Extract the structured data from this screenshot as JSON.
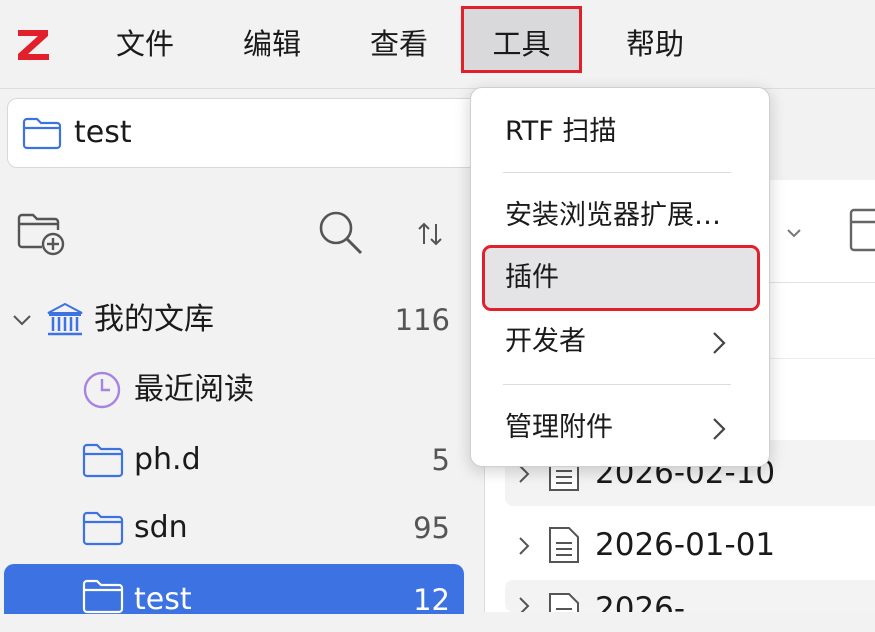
{
  "menubar": {
    "logo_icon": "zotero-z-logo",
    "items": [
      {
        "label": "文件"
      },
      {
        "label": "编辑"
      },
      {
        "label": "查看"
      },
      {
        "label": "工具"
      },
      {
        "label": "帮助"
      }
    ]
  },
  "collection_bar": {
    "icon": "folder-icon",
    "label": "test"
  },
  "sidebar": {
    "toolbar_icons": [
      "new-collection-icon",
      "search-icon",
      "sort-icon"
    ],
    "tree": [
      {
        "label": "我的文库",
        "count": "116",
        "icon": "library-icon"
      },
      {
        "label": "最近阅读",
        "count": "",
        "icon": "clock-icon"
      },
      {
        "label": "ph.d",
        "count": "5",
        "icon": "folder-icon"
      },
      {
        "label": "sdn",
        "count": "95",
        "icon": "folder-icon"
      },
      {
        "label": "test",
        "count": "12",
        "icon": "folder-icon"
      }
    ]
  },
  "items_pane": {
    "rows": [
      {
        "title": "2026-02-10",
        "icon": "document-icon"
      },
      {
        "title": "2026-01-01",
        "icon": "document-icon"
      },
      {
        "title": "2026-",
        "icon": "document-icon"
      }
    ]
  },
  "tools_menu": {
    "items": [
      {
        "label": "RTF 扫描"
      },
      {
        "label": "安装浏览器扩展…"
      },
      {
        "label": "插件"
      },
      {
        "label": "开发者"
      },
      {
        "label": "管理附件"
      }
    ]
  },
  "colors": {
    "accent": "#3d72e3",
    "highlight": "#e0202a",
    "logo": "#e2202c"
  }
}
